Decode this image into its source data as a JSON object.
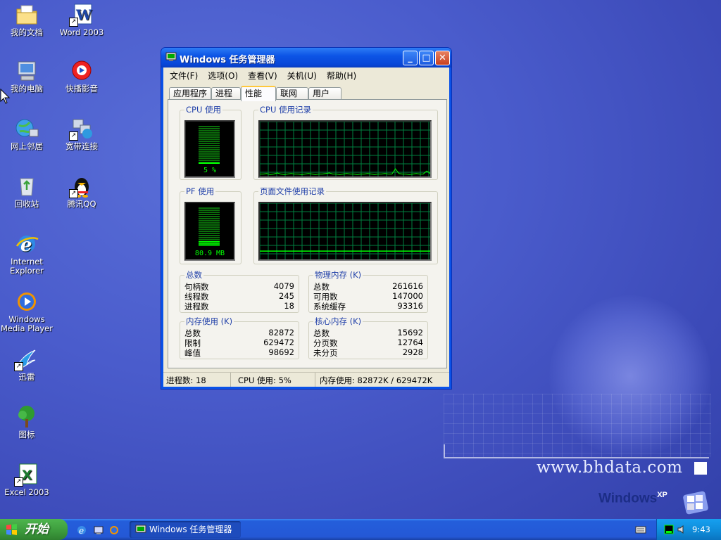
{
  "desktop": {
    "icons": [
      {
        "label": "我的文档"
      },
      {
        "label": "Word 2003"
      },
      {
        "label": "我的电脑"
      },
      {
        "label": "快播影音"
      },
      {
        "label": "网上邻居"
      },
      {
        "label": "宽带连接"
      },
      {
        "label": "回收站"
      },
      {
        "label": "腾讯QQ"
      },
      {
        "label": "Internet\nExplorer"
      },
      {
        "label": "Windows\nMedia Player"
      },
      {
        "label": "迅雷"
      },
      {
        "label": "图标"
      },
      {
        "label": "Excel 2003"
      }
    ],
    "watermark": "www.bhdata.com",
    "brand": "Windows",
    "brand_sup": "XP"
  },
  "window": {
    "title": "Windows 任务管理器",
    "controls": {
      "minimize": "_",
      "maximize": "□",
      "close": "✕"
    },
    "menu": [
      "文件(F)",
      "选项(O)",
      "查看(V)",
      "关机(U)",
      "帮助(H)"
    ],
    "tabs": [
      "应用程序",
      "进程",
      "性能",
      "联网",
      "用户"
    ],
    "active_tab": "性能",
    "performance": {
      "cpu_usage": {
        "title": "CPU 使用",
        "value": "5 %",
        "percent": 5
      },
      "cpu_history": {
        "title": "CPU 使用记录",
        "samples": [
          2,
          2,
          3,
          1,
          2,
          4,
          2,
          1,
          2,
          3,
          2,
          2,
          1,
          2,
          3,
          2,
          1,
          2,
          2,
          3,
          4,
          2,
          2,
          1,
          2,
          3,
          2,
          2,
          1,
          2,
          2,
          3,
          2,
          1,
          2,
          2,
          3,
          2,
          2,
          12,
          3,
          2,
          2,
          1,
          2,
          3,
          2,
          2,
          8,
          3
        ]
      },
      "pf_usage": {
        "title": "PF 使用",
        "value": "80.9 MB",
        "percent": 13
      },
      "pf_history": {
        "title": "页面文件使用记录",
        "percent": 13
      },
      "totals": {
        "title": "总数",
        "rows": [
          {
            "k": "句柄数",
            "v": "4079"
          },
          {
            "k": "线程数",
            "v": "245"
          },
          {
            "k": "进程数",
            "v": "18"
          }
        ]
      },
      "physical": {
        "title": "物理内存 (K)",
        "rows": [
          {
            "k": "总数",
            "v": "261616"
          },
          {
            "k": "可用数",
            "v": "147000"
          },
          {
            "k": "系统缓存",
            "v": "93316"
          }
        ]
      },
      "commit": {
        "title": "内存使用 (K)",
        "rows": [
          {
            "k": "总数",
            "v": "82872"
          },
          {
            "k": "限制",
            "v": "629472"
          },
          {
            "k": "峰值",
            "v": "98692"
          }
        ]
      },
      "kernel": {
        "title": "核心内存 (K)",
        "rows": [
          {
            "k": "总数",
            "v": "15692"
          },
          {
            "k": "分页数",
            "v": "12764"
          },
          {
            "k": "未分页",
            "v": "2928"
          }
        ]
      }
    },
    "status": {
      "processes": "进程数: 18",
      "cpu": "CPU 使用: 5%",
      "memory": "内存使用: 82872K / 629472K"
    }
  },
  "taskbar": {
    "start_label": "开始",
    "task": "Windows 任务管理器",
    "clock": "9:43"
  },
  "colors": {
    "graph_grid": "#008040",
    "graph_line": "#00ff00",
    "titlebar": "#0a52e8",
    "taskbar": "#245edb"
  }
}
